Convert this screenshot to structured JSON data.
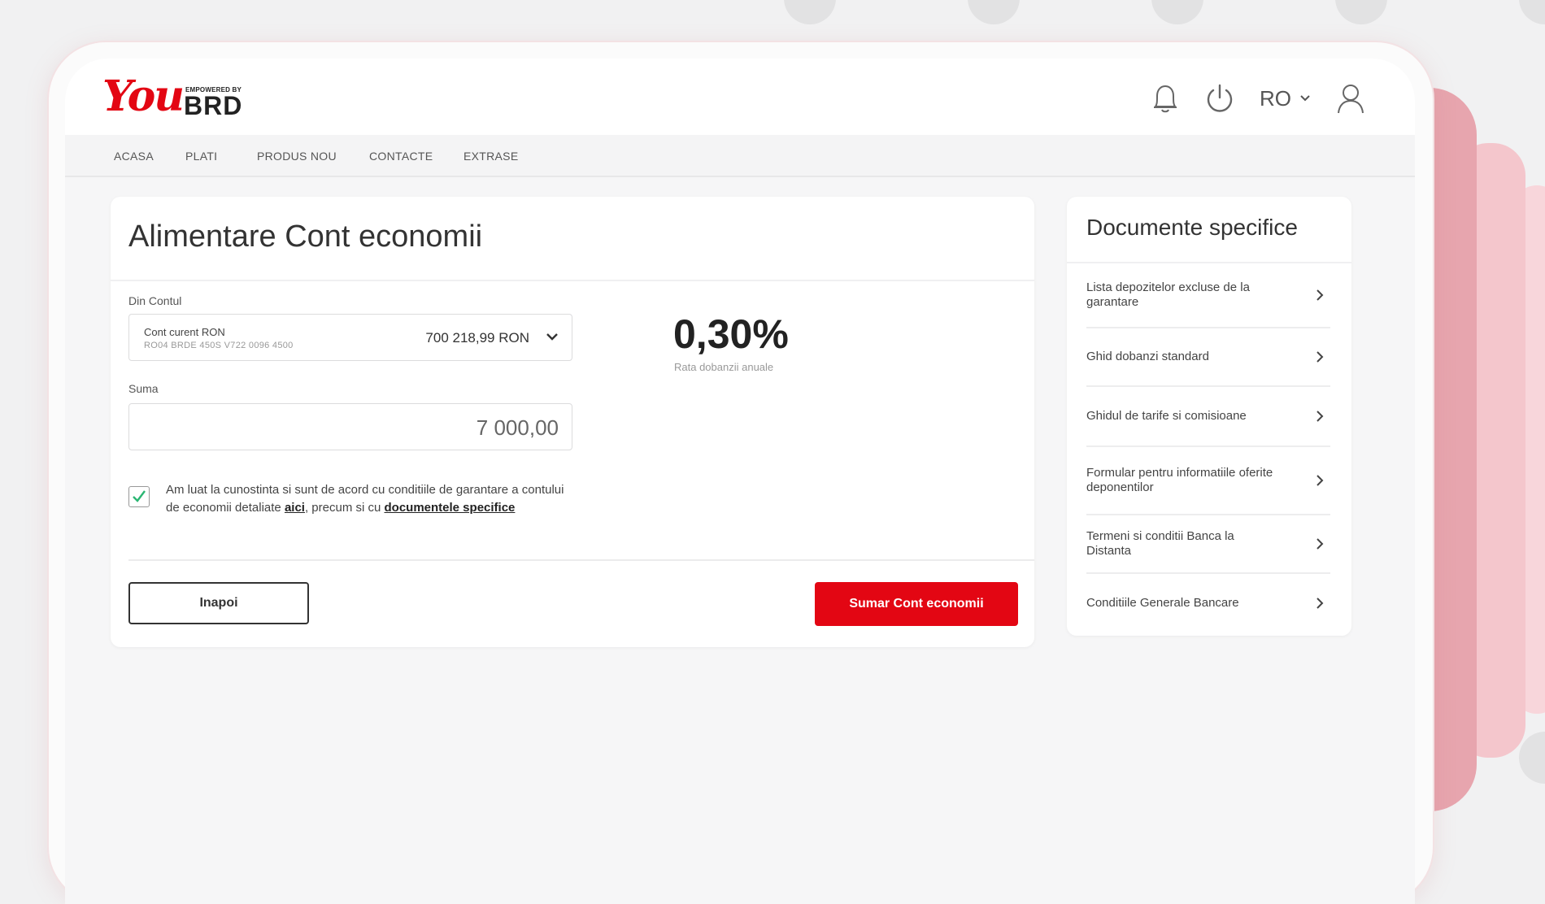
{
  "brand": {
    "logo_you": "You",
    "logo_empowered": "EMPOWERED BY",
    "logo_brd": "BRD",
    "accent_color": "#e30613"
  },
  "header": {
    "icons": [
      "bell-icon",
      "power-icon",
      "user-icon"
    ],
    "language": "RO"
  },
  "nav": {
    "items": [
      {
        "label": "ACASA"
      },
      {
        "label": "PLATI"
      },
      {
        "label": "PRODUS NOU"
      },
      {
        "label": "CONTACTE"
      },
      {
        "label": "EXTRASE"
      }
    ]
  },
  "form": {
    "title": "Alimentare Cont economii",
    "from_account_label": "Din Contul",
    "account": {
      "name": "Cont curent RON",
      "iban": "RO04 BRDE 450S V722 0096 4500",
      "balance": "700 218,99 RON"
    },
    "amount_label": "Suma",
    "amount_value": "7 000,00",
    "rate": {
      "value": "0,30%",
      "label": "Rata dobanzii anuale"
    },
    "consent": {
      "checked": true,
      "text_part1": "Am luat la cunostinta si sunt de acord cu conditiile de garantare a contului de economii detaliate ",
      "link1": "aici",
      "text_part2": ", precum si cu ",
      "link2": "documentele specifice"
    },
    "back_button": "Inapoi",
    "submit_button": "Sumar Cont economii"
  },
  "documents": {
    "title": "Documente specifice",
    "items": [
      {
        "label": "Lista depozitelor excluse de la garantare"
      },
      {
        "label": "Ghid dobanzi standard"
      },
      {
        "label": "Ghidul de tarife si comisioane"
      },
      {
        "label": "Formular pentru informatiile oferite deponentilor"
      },
      {
        "label": "Termeni si conditii Banca la Distanta"
      },
      {
        "label": "Conditiile Generale Bancare"
      }
    ]
  }
}
